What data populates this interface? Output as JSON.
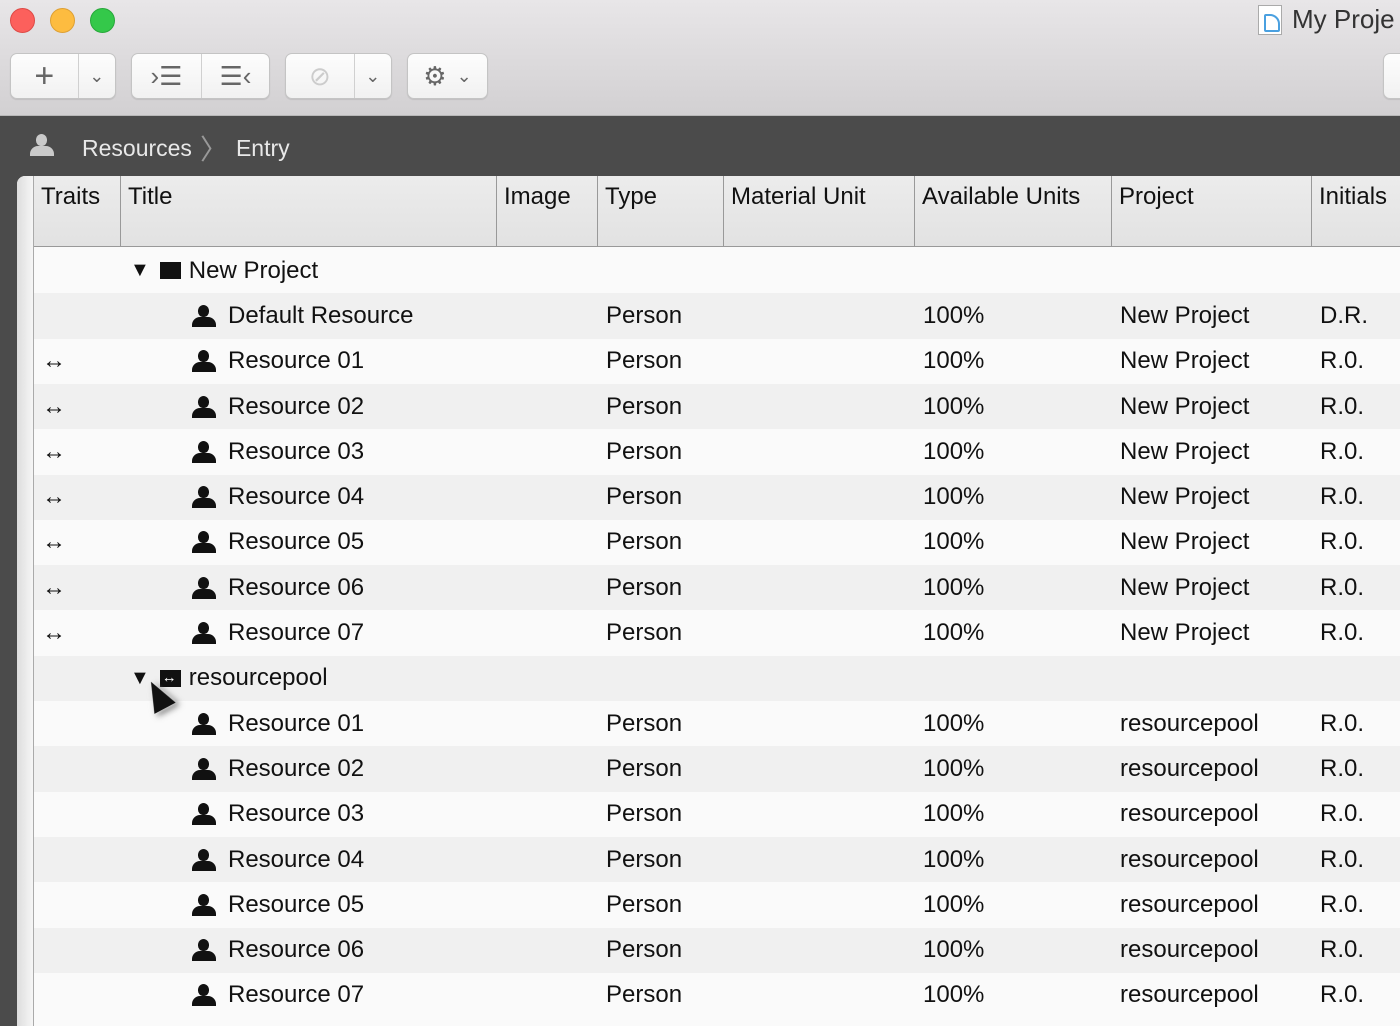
{
  "window": {
    "title": "My Proje",
    "icon": "project-document-icon"
  },
  "toolbar": {
    "buttons": [
      "add",
      "add-menu",
      "indent",
      "outdent",
      "attach",
      "attach-menu",
      "settings",
      "settings-menu"
    ]
  },
  "breadcrumb": {
    "items": [
      "Resources",
      "Entry"
    ]
  },
  "columns": [
    "Traits",
    "Title",
    "Image",
    "Type",
    "Material Unit",
    "Available Units",
    "Project",
    "Initials"
  ],
  "rows": [
    {
      "kind": "group",
      "title": "New Project",
      "icon": "folder-icon"
    },
    {
      "kind": "item",
      "traits": "",
      "title": "Default Resource",
      "type": "Person",
      "available": "100%",
      "project": "New Project",
      "initials": "D.R."
    },
    {
      "kind": "item",
      "traits": "↔",
      "title": "Resource 01",
      "type": "Person",
      "available": "100%",
      "project": "New Project",
      "initials": "R.0."
    },
    {
      "kind": "item",
      "traits": "↔",
      "title": "Resource 02",
      "type": "Person",
      "available": "100%",
      "project": "New Project",
      "initials": "R.0."
    },
    {
      "kind": "item",
      "traits": "↔",
      "title": "Resource 03",
      "type": "Person",
      "available": "100%",
      "project": "New Project",
      "initials": "R.0."
    },
    {
      "kind": "item",
      "traits": "↔",
      "title": "Resource 04",
      "type": "Person",
      "available": "100%",
      "project": "New Project",
      "initials": "R.0."
    },
    {
      "kind": "item",
      "traits": "↔",
      "title": "Resource 05",
      "type": "Person",
      "available": "100%",
      "project": "New Project",
      "initials": "R.0."
    },
    {
      "kind": "item",
      "traits": "↔",
      "title": "Resource 06",
      "type": "Person",
      "available": "100%",
      "project": "New Project",
      "initials": "R.0."
    },
    {
      "kind": "item",
      "traits": "↔",
      "title": "Resource 07",
      "type": "Person",
      "available": "100%",
      "project": "New Project",
      "initials": "R.0."
    },
    {
      "kind": "group",
      "title": "resourcepool",
      "icon": "shared-folder-icon"
    },
    {
      "kind": "item",
      "traits": "",
      "title": "Resource 01",
      "type": "Person",
      "available": "100%",
      "project": "resourcepool",
      "initials": "R.0."
    },
    {
      "kind": "item",
      "traits": "",
      "title": "Resource 02",
      "type": "Person",
      "available": "100%",
      "project": "resourcepool",
      "initials": "R.0."
    },
    {
      "kind": "item",
      "traits": "",
      "title": "Resource 03",
      "type": "Person",
      "available": "100%",
      "project": "resourcepool",
      "initials": "R.0."
    },
    {
      "kind": "item",
      "traits": "",
      "title": "Resource 04",
      "type": "Person",
      "available": "100%",
      "project": "resourcepool",
      "initials": "R.0."
    },
    {
      "kind": "item",
      "traits": "",
      "title": "Resource 05",
      "type": "Person",
      "available": "100%",
      "project": "resourcepool",
      "initials": "R.0."
    },
    {
      "kind": "item",
      "traits": "",
      "title": "Resource 06",
      "type": "Person",
      "available": "100%",
      "project": "resourcepool",
      "initials": "R.0."
    },
    {
      "kind": "item",
      "traits": "",
      "title": "Resource 07",
      "type": "Person",
      "available": "100%",
      "project": "resourcepool",
      "initials": "R.0."
    }
  ]
}
